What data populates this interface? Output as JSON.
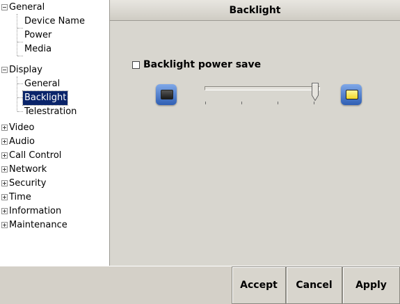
{
  "sidebar": {
    "items": [
      {
        "label": "General",
        "expanded": true
      },
      {
        "label": "Device Name"
      },
      {
        "label": "Power"
      },
      {
        "label": "Media"
      },
      {
        "label": "Display",
        "expanded": true
      },
      {
        "label": "General"
      },
      {
        "label": "Backlight",
        "selected": true
      },
      {
        "label": "Telestration"
      },
      {
        "label": "Video",
        "expanded": false
      },
      {
        "label": "Audio",
        "expanded": false
      },
      {
        "label": "Call Control",
        "expanded": false
      },
      {
        "label": "Network",
        "expanded": false
      },
      {
        "label": "Security",
        "expanded": false
      },
      {
        "label": "Time",
        "expanded": false
      },
      {
        "label": "Information",
        "expanded": false
      },
      {
        "label": "Maintenance",
        "expanded": false
      }
    ]
  },
  "panel": {
    "title": "Backlight",
    "power_save_label": "Backlight power save",
    "power_save_checked": false,
    "brightness_level": 0.95,
    "dim_icon": "dim-screen-icon",
    "bright_icon": "bright-screen-icon"
  },
  "buttons": {
    "accept": "Accept",
    "cancel": "Cancel",
    "apply": "Apply"
  },
  "colors": {
    "selection": "#0a246a",
    "icon_blue": "#2f5fb4"
  }
}
